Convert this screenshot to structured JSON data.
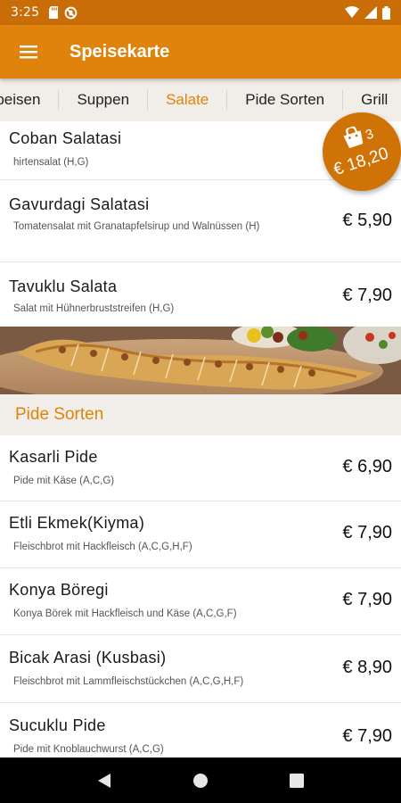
{
  "status_bar": {
    "time": "3:25",
    "left_icons": [
      "sd-card-icon",
      "blocked-icon"
    ],
    "right_icons": [
      "wifi-icon",
      "signal-icon",
      "battery-icon"
    ]
  },
  "app_bar": {
    "title": "Speisekarte",
    "menu_icon": "hamburger-menu-icon"
  },
  "tabs": [
    {
      "label": "Speisen",
      "active": false
    },
    {
      "label": "Suppen",
      "active": false
    },
    {
      "label": "Salate",
      "active": true
    },
    {
      "label": "Pide Sorten",
      "active": false
    },
    {
      "label": "Grill",
      "active": false
    }
  ],
  "cart": {
    "count": "3",
    "total": "€ 18,20",
    "icon": "shopping-bag-icon"
  },
  "salads": [
    {
      "name": "Coban Salatasi",
      "desc": "hirtensalat (H,G)",
      "price": ""
    },
    {
      "name": "Gavurdagi Salatasi",
      "desc": "Tomatensalat mit Granatapfelsirup und Walnüssen (H)",
      "price": "€ 5,90"
    },
    {
      "name": "Tavuklu Salata",
      "desc": "Salat mit Hühnerbruststreifen (H,G)",
      "price": "€ 7,90"
    }
  ],
  "pide_section": {
    "title": "Pide Sorten",
    "items": [
      {
        "name": "Kasarli Pide",
        "desc": "Pide mit Käse (A,C,G)",
        "price": "€ 6,90"
      },
      {
        "name": "Etli Ekmek(Kiyma)",
        "desc": "Fleischbrot mit Hackfleisch (A,C,G,H,F)",
        "price": "€ 7,90"
      },
      {
        "name": "Konya Böregi",
        "desc": "Konya Börek mit Hackfleisch und  Käse (A,C,G,F)",
        "price": "€ 7,90"
      },
      {
        "name": "Bicak Arasi (Kusbasi)",
        "desc": "Fleischbrot mit Lammfleischstückchen  (A,C,G,H,F)",
        "price": "€ 8,90"
      },
      {
        "name": "Sucuklu Pide",
        "desc": "Pide mit Knoblauchwurst (A,C,G)",
        "price": "€ 7,90"
      }
    ]
  },
  "nav_bar": {
    "icons": [
      "back-icon",
      "home-icon",
      "recents-icon"
    ]
  }
}
